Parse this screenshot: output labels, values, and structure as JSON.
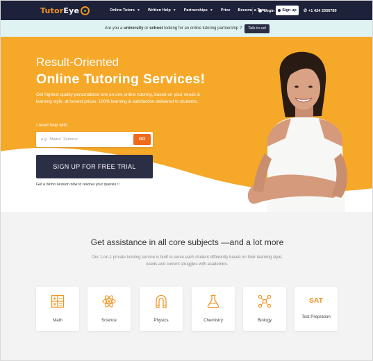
{
  "brand": {
    "part1": "Tutor",
    "part2": "Eye"
  },
  "nav": {
    "items": [
      {
        "label": "Online Tutors",
        "caret": true
      },
      {
        "label": "Written Help",
        "caret": true
      },
      {
        "label": "Partnerships",
        "caret": true
      },
      {
        "label": "Price",
        "caret": false
      },
      {
        "label": "Become a Tutor",
        "caret": false
      }
    ],
    "login_label": "Login",
    "signup_label": "Sign up",
    "phone": "+1 424 2556789"
  },
  "announcement": {
    "prefix": "Are you a ",
    "bold1": "university",
    "mid": " or ",
    "bold2": "school",
    "suffix": " looking for an online tutoring partnership ?",
    "button_label": "Talk to us!"
  },
  "hero": {
    "title_line1": "Result-Oriented",
    "title_line2": "Online Tutoring Services!",
    "description": "Get highest quality personalized one on one online tutoring, based on your needs & learning style, at honest prices. 100% learning & satisfaction delivered to students.",
    "help_label": "I need help with.",
    "search_placeholder": "e.g. 'Maths' 'Science'",
    "go_label": "GO",
    "trial_label": "SIGN UP FOR FREE TRIAL",
    "demo_text": "Get a demo session now to resolve your queries !!"
  },
  "subjects": {
    "title": "Get assistance in all core subjects —and a lot more",
    "description": "Our 1-on-1 private tutoring service is built to serve each student differently based on their learning style, needs and current struggles with academics.",
    "items": [
      {
        "label": "Math",
        "icon": "calculator-icon"
      },
      {
        "label": "Science",
        "icon": "atom-icon"
      },
      {
        "label": "Physics",
        "icon": "magnet-icon"
      },
      {
        "label": "Chemistry",
        "icon": "flask-icon"
      },
      {
        "label": "Biology",
        "icon": "molecule-icon"
      },
      {
        "label": "Test Prepration",
        "icon": "sat-icon",
        "badge": "SAT"
      }
    ]
  },
  "colors": {
    "nav_bg": "#1d2139",
    "accent_orange": "#f6a828",
    "go_button": "#f06a1c",
    "dark_button": "#2b2f45",
    "announce_bg": "#dff3f2",
    "icon_orange": "#f29422"
  }
}
